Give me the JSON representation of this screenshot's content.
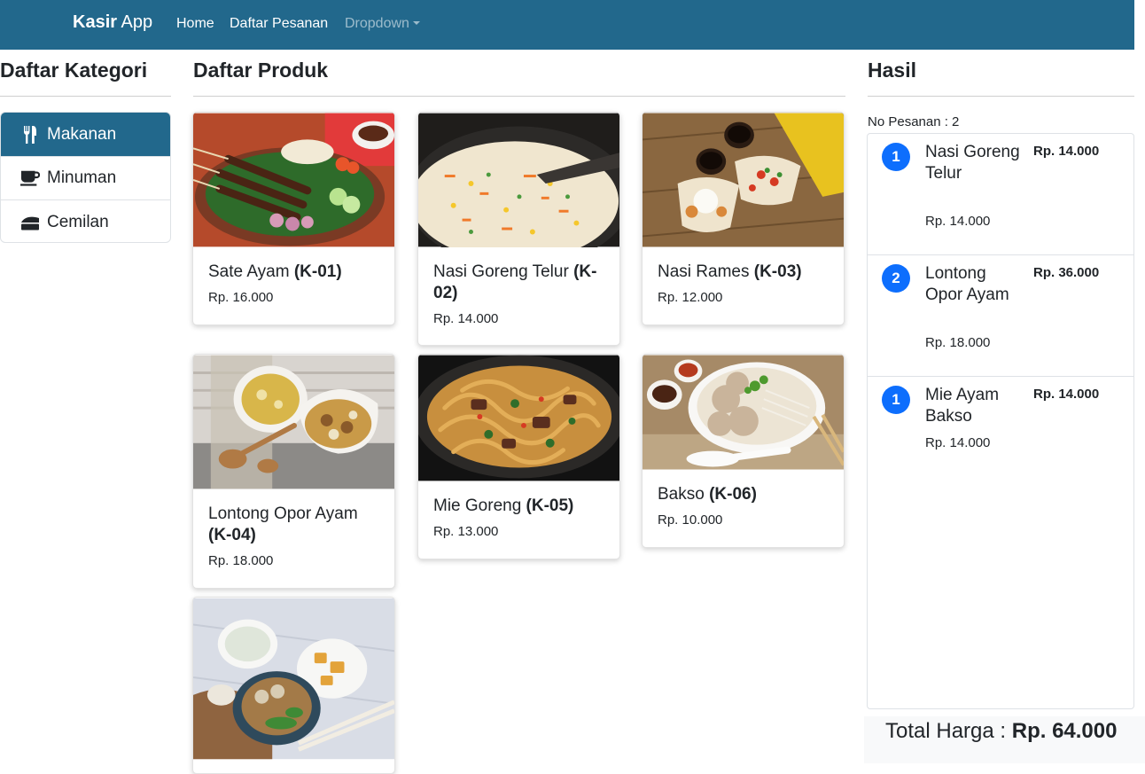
{
  "navbar": {
    "brand_bold": "Kasir",
    "brand_rest": " App",
    "links": [
      "Home",
      "Daftar Pesanan",
      "Dropdown"
    ]
  },
  "categories": {
    "title": "Daftar Kategori",
    "items": [
      {
        "label": "Makanan",
        "icon": "utensils-icon",
        "active": true
      },
      {
        "label": "Minuman",
        "icon": "coffee-icon",
        "active": false
      },
      {
        "label": "Cemilan",
        "icon": "cheese-icon",
        "active": false
      }
    ]
  },
  "products": {
    "title": "Daftar Produk",
    "items": [
      {
        "name": "Sate Ayam ",
        "code": "(K-01)",
        "price": "Rp. 16.000"
      },
      {
        "name": "Nasi Goreng Telur ",
        "code": "(K-02)",
        "price": "Rp. 14.000"
      },
      {
        "name": "Nasi Rames ",
        "code": "(K-03)",
        "price": "Rp. 12.000"
      },
      {
        "name": "Lontong Opor Ayam ",
        "code": "(K-04)",
        "price": "Rp. 18.000"
      },
      {
        "name": "Mie Goreng ",
        "code": "(K-05)",
        "price": "Rp. 13.000"
      },
      {
        "name": "Bakso ",
        "code": "(K-06)",
        "price": "Rp. 10.000"
      }
    ]
  },
  "result": {
    "title": "Hasil",
    "order_no": "No Pesanan : 2",
    "items": [
      {
        "qty": "1",
        "name": "Nasi Goreng Telur",
        "unit_price": "Rp. 14.000",
        "subtotal": "Rp. 14.000"
      },
      {
        "qty": "2",
        "name": "Lontong Opor Ayam",
        "unit_price": "Rp. 18.000",
        "subtotal": "Rp. 36.000"
      },
      {
        "qty": "1",
        "name": "Mie Ayam Bakso",
        "unit_price": "Rp. 14.000",
        "subtotal": "Rp. 14.000"
      }
    ],
    "total_label": "Total Harga : ",
    "total_value": "Rp. 64.000"
  },
  "colors": {
    "navbar": "#22688c",
    "active_category": "#22688c",
    "qty_badge": "#0d6efd"
  }
}
